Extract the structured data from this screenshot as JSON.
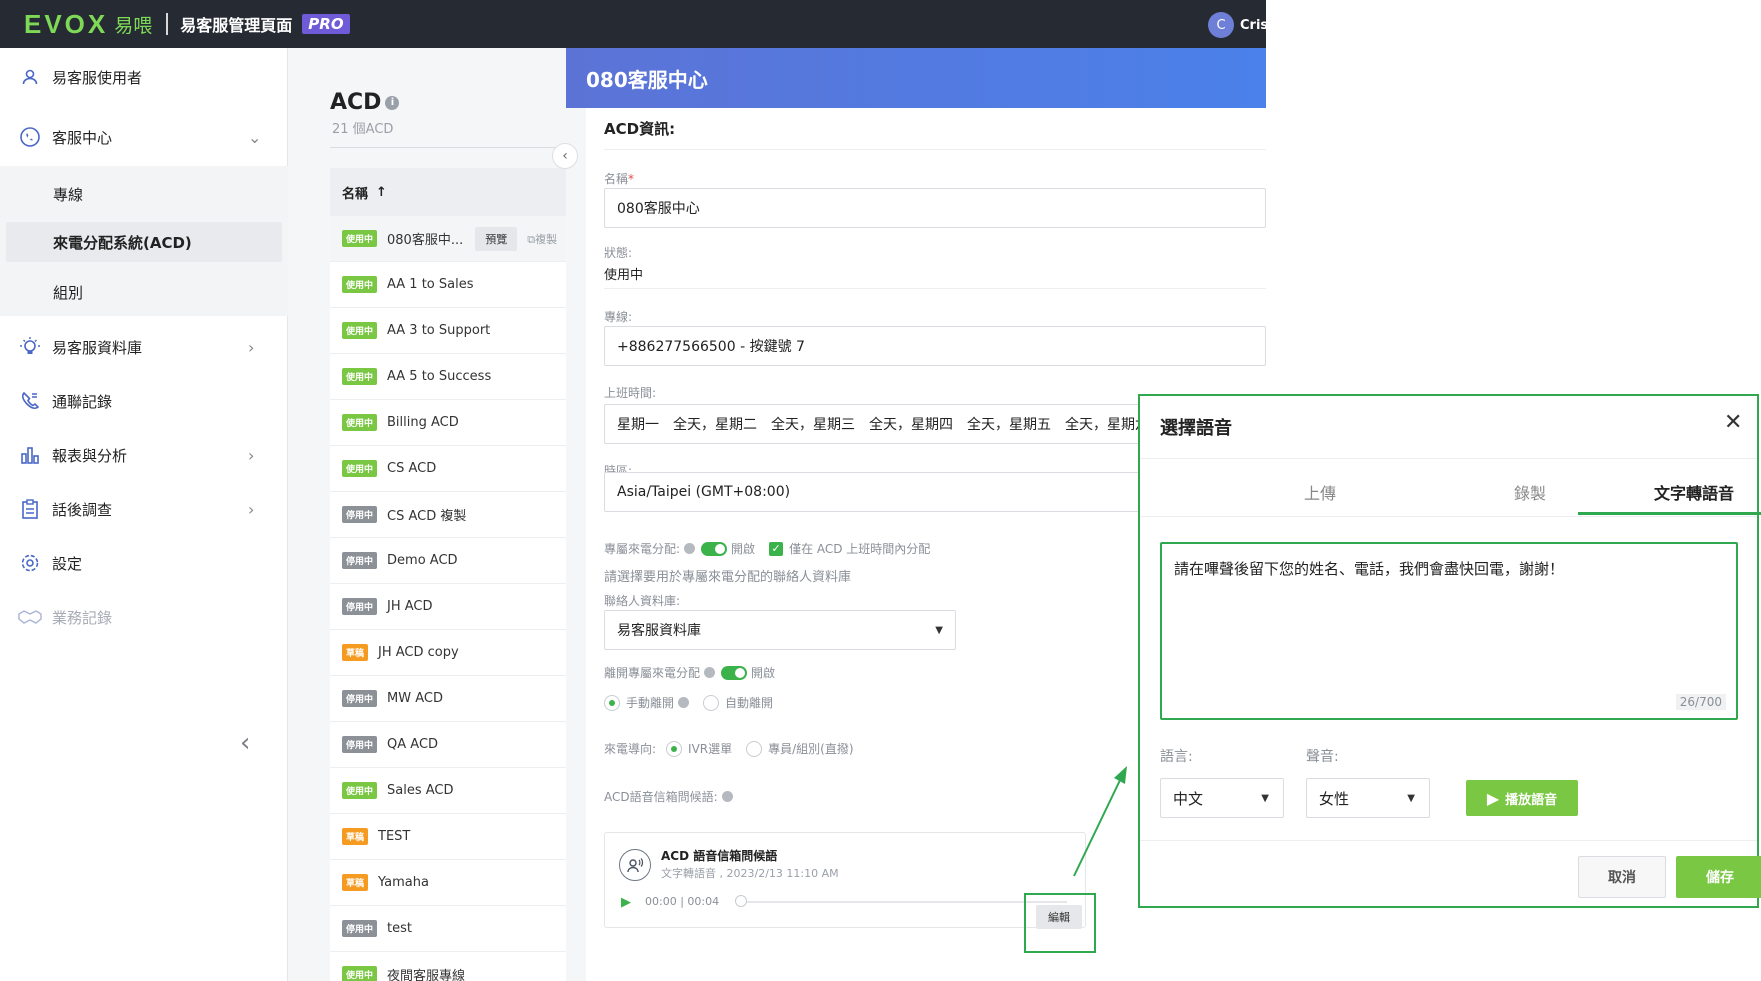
{
  "topbar": {
    "logo": "EVOX",
    "logo_cn": "易喂",
    "title": "易客服管理頁面",
    "badge": "PRO",
    "user_initial": "C",
    "user_name": "Crist"
  },
  "sidebar": {
    "items": [
      {
        "label": "易客服使用者",
        "icon": "user-icon"
      },
      {
        "label": "客服中心",
        "icon": "call-center-icon"
      },
      {
        "label": "易客服資料庫",
        "icon": "bulb-icon"
      },
      {
        "label": "通聯記錄",
        "icon": "phone-log-icon"
      },
      {
        "label": "報表與分析",
        "icon": "chart-icon"
      },
      {
        "label": "話後調查",
        "icon": "survey-icon"
      },
      {
        "label": "設定",
        "icon": "gear-icon"
      },
      {
        "label": "業務記錄",
        "icon": "handshake-icon"
      }
    ],
    "sub_items": [
      "專線",
      "來電分配系統(ACD)",
      "組別"
    ]
  },
  "list": {
    "title": "ACD",
    "count": "21 個ACD",
    "column_name": "名稱",
    "preview_label": "預覽",
    "copy_label": "複製",
    "rows": [
      {
        "status": "使用中",
        "kind": "active",
        "name": "080客服中..."
      },
      {
        "status": "使用中",
        "kind": "active",
        "name": "AA 1 to Sales"
      },
      {
        "status": "使用中",
        "kind": "active",
        "name": "AA 3 to Support"
      },
      {
        "status": "使用中",
        "kind": "active",
        "name": "AA 5 to Success"
      },
      {
        "status": "使用中",
        "kind": "active",
        "name": "Billing ACD"
      },
      {
        "status": "使用中",
        "kind": "active",
        "name": "CS ACD"
      },
      {
        "status": "停用中",
        "kind": "stopped",
        "name": "CS ACD 複製"
      },
      {
        "status": "停用中",
        "kind": "stopped",
        "name": "Demo ACD"
      },
      {
        "status": "停用中",
        "kind": "stopped",
        "name": "JH ACD"
      },
      {
        "status": "草稿",
        "kind": "draft",
        "name": "JH ACD copy"
      },
      {
        "status": "停用中",
        "kind": "stopped",
        "name": "MW ACD"
      },
      {
        "status": "停用中",
        "kind": "stopped",
        "name": "QA ACD"
      },
      {
        "status": "使用中",
        "kind": "active",
        "name": "Sales ACD"
      },
      {
        "status": "草稿",
        "kind": "draft",
        "name": "TEST"
      },
      {
        "status": "草稿",
        "kind": "draft",
        "name": "Yamaha"
      },
      {
        "status": "停用中",
        "kind": "stopped",
        "name": "test"
      },
      {
        "status": "使用中",
        "kind": "active",
        "name": "夜間客服專線"
      }
    ]
  },
  "detail": {
    "header": "080客服中心",
    "section_title": "ACD資訊:",
    "name_label": "名稱",
    "name_value": "080客服中心",
    "status_label": "狀態:",
    "status_value": "使用中",
    "line_label": "專線:",
    "line_value": "+886277566500 - 按鍵號 7",
    "hours_label": "上班時間:",
    "hours_value": "星期一　全天，星期二　全天，星期三　全天，星期四　全天，星期五　全天，星期六",
    "tz_label": "時區:",
    "tz_value": "Asia/Taipei (GMT+08:00)",
    "dedicated_label": "專屬來電分配:",
    "on_label": "開啟",
    "only_hours_label": "僅在 ACD 上班時間內分配",
    "choose_db_hint": "請選擇要用於專屬來電分配的聯絡人資料庫",
    "contact_db_label": "聯絡人資料庫:",
    "contact_db_value": "易客服資料庫",
    "leave_label": "離開專屬來電分配",
    "leave_on_label": "開啟",
    "manual_leave": "手動離開",
    "auto_leave": "自動離開",
    "routing_label": "來電導向:",
    "routing_ivr": "IVR選單",
    "routing_direct": "專員/組別(直撥)",
    "vm_label": "ACD語音信箱問候語:",
    "vm_title": "ACD 語音信箱問候語",
    "vm_sub": "文字轉語音 , 2023/2/13 11:10 AM",
    "vm_time": "00:00 | 00:04",
    "edit_label": "編輯"
  },
  "dialog": {
    "title": "選擇語音",
    "tabs": [
      "上傳",
      "錄製",
      "文字轉語音"
    ],
    "text": "請在嗶聲後留下您的姓名、電話，我們會盡快回電，謝謝！",
    "count": "26/700",
    "lang_label": "語言:",
    "voice_label": "聲音:",
    "lang_value": "中文",
    "voice_value": "女性",
    "play_label": "播放語音",
    "cancel_label": "取消",
    "save_label": "儲存"
  },
  "colors": {
    "accent_green": "#7ac744",
    "highlight_green": "#2fa84f",
    "header_blue": "#4a81ea",
    "topbar": "#262b33"
  }
}
